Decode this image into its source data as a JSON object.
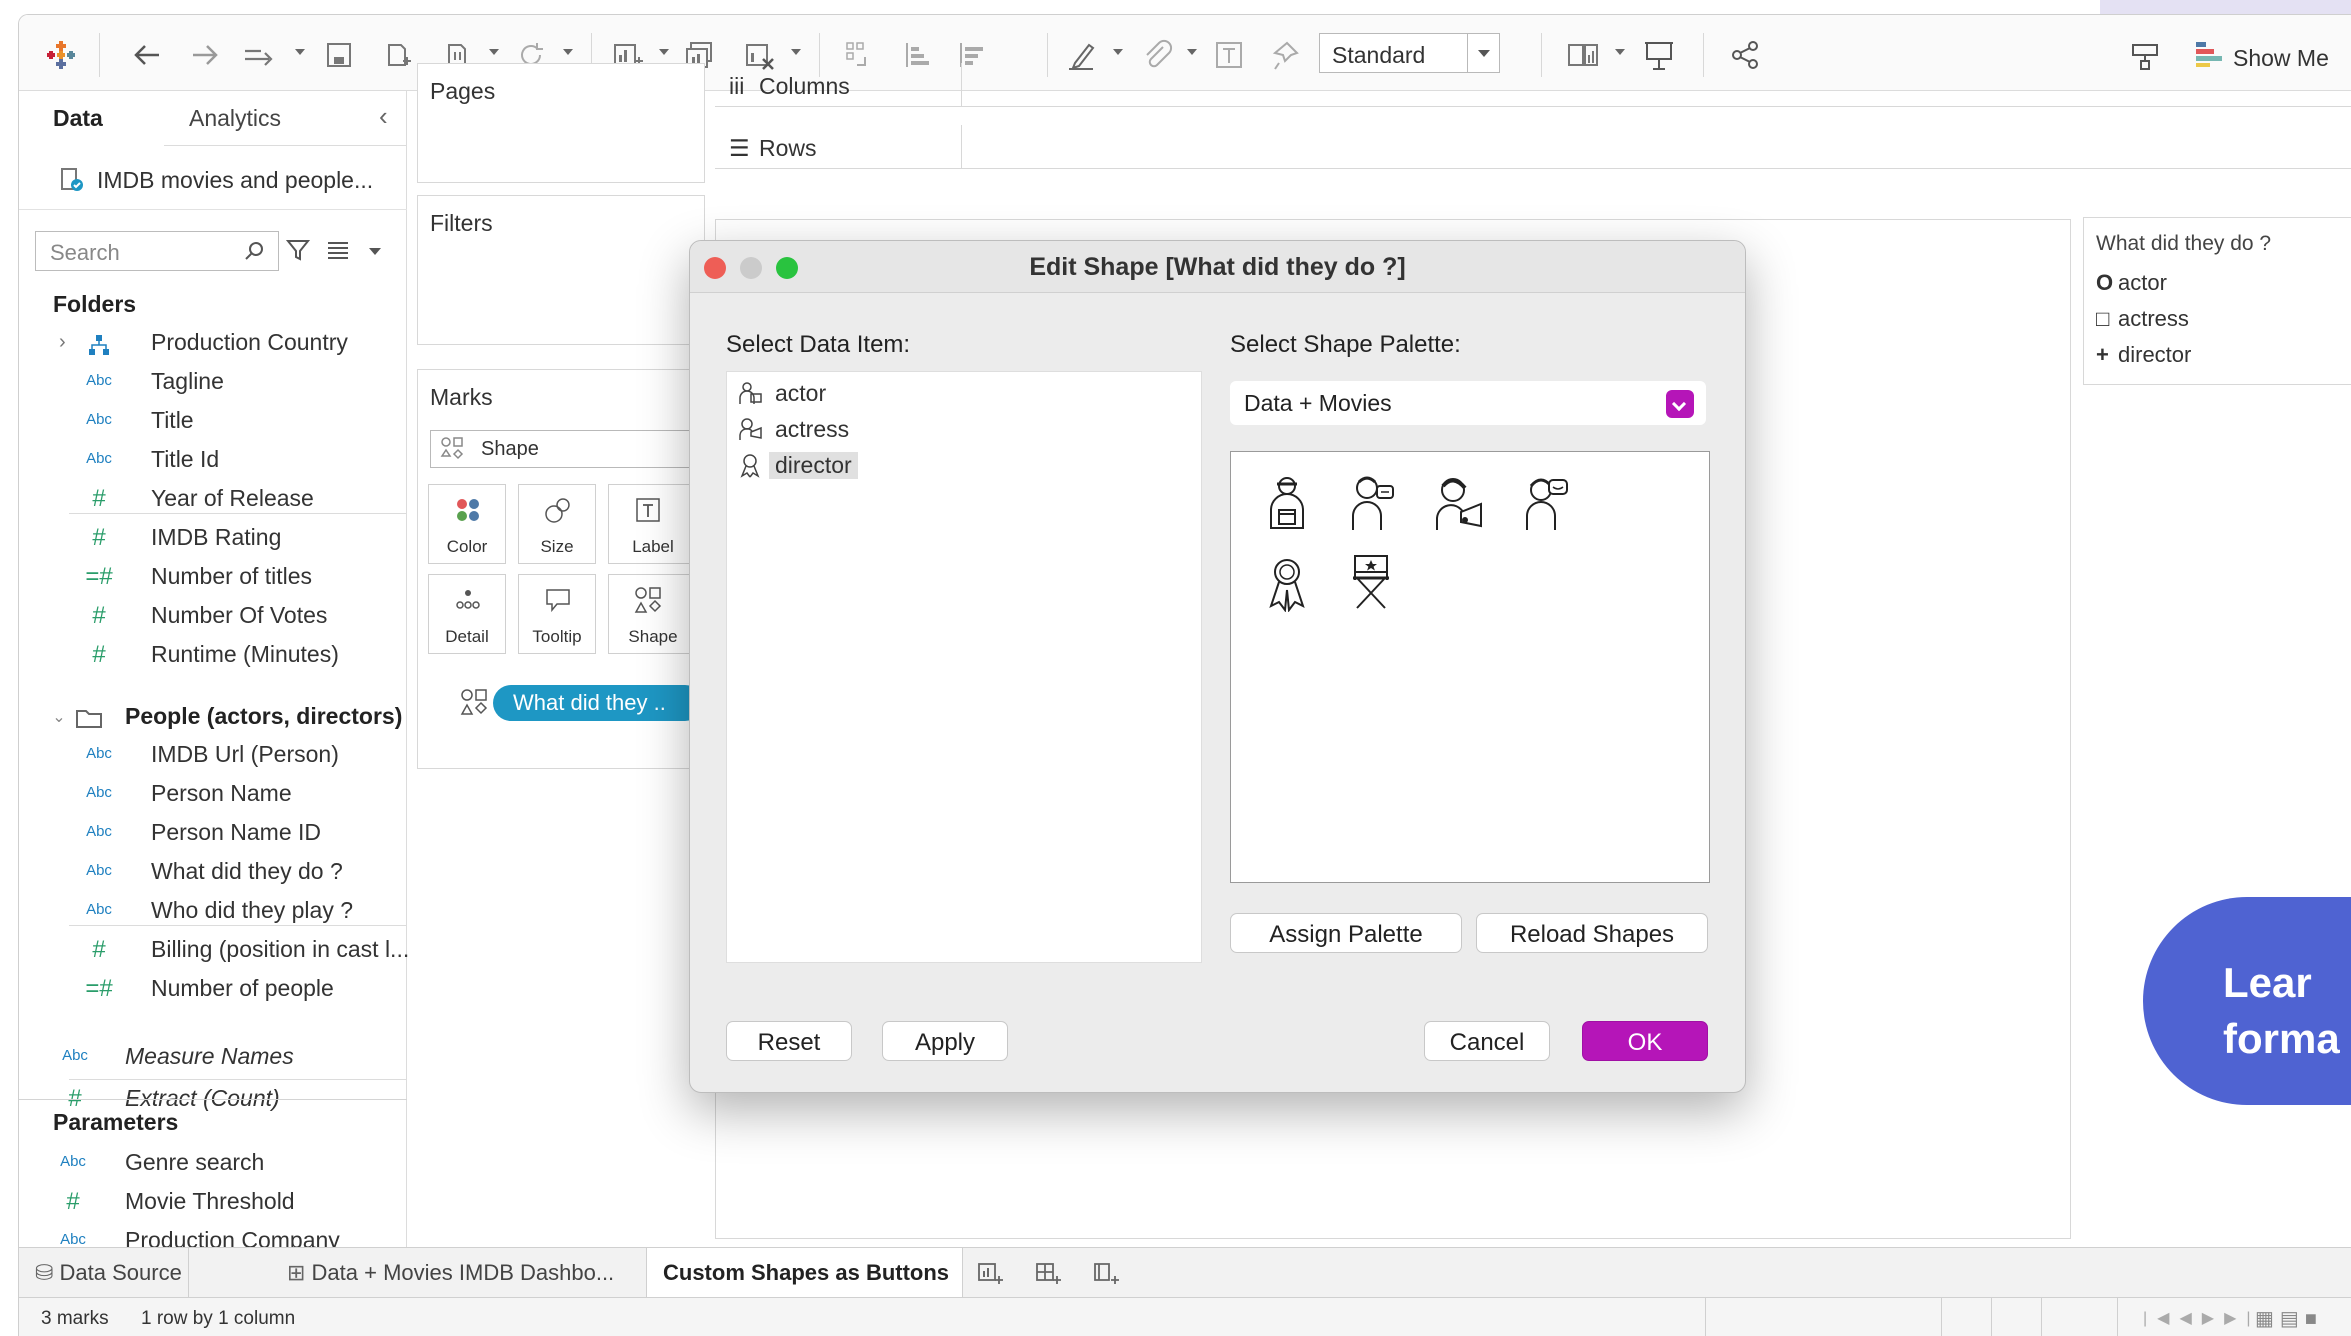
{
  "toolbar": {
    "standard_select": "Standard",
    "show_me": "Show Me"
  },
  "data_pane": {
    "tabs": {
      "data": "Data",
      "analytics": "Analytics"
    },
    "datasource": "IMDB movies and people...",
    "search_placeholder": "Search",
    "folders_heading": "Folders",
    "folder_fields": [
      {
        "type": "hier",
        "label": "Production Country"
      },
      {
        "type": "Abc",
        "label": "Tagline"
      },
      {
        "type": "Abc",
        "label": "Title"
      },
      {
        "type": "Abc",
        "label": "Title Id"
      },
      {
        "type": "#",
        "label": "Year of Release"
      },
      {
        "type": "#",
        "label": "IMDB Rating"
      },
      {
        "type": "=#",
        "label": "Number of titles"
      },
      {
        "type": "#",
        "label": "Number Of Votes"
      },
      {
        "type": "#",
        "label": "Runtime (Minutes)"
      }
    ],
    "people_folder": "People (actors, directors)",
    "people_fields": [
      {
        "type": "Abc",
        "label": "IMDB Url (Person)"
      },
      {
        "type": "Abc",
        "label": "Person Name"
      },
      {
        "type": "Abc",
        "label": "Person Name ID"
      },
      {
        "type": "Abc",
        "label": "What did they do ?"
      },
      {
        "type": "Abc",
        "label": "Who did they play ?"
      },
      {
        "type": "#",
        "label": "Billing (position in cast l..."
      },
      {
        "type": "=#",
        "label": "Number of people"
      }
    ],
    "measure_names": "Measure Names",
    "extract_count": "Extract (Count)",
    "parameters_heading": "Parameters",
    "parameters": [
      {
        "type": "Abc",
        "label": "Genre search"
      },
      {
        "type": "#",
        "label": "Movie Threshold"
      },
      {
        "type": "Abc",
        "label": "Production Company"
      }
    ]
  },
  "shelves": {
    "pages": "Pages",
    "filters": "Filters",
    "marks": "Marks",
    "marks_type": "Shape",
    "marks_buttons": [
      "Color",
      "Size",
      "Label",
      "Detail",
      "Tooltip",
      "Shape"
    ],
    "pill": "What did they ..",
    "columns": "Columns",
    "rows": "Rows"
  },
  "legend": {
    "title": "What did they do ?",
    "items": [
      {
        "symbol": "O",
        "label": "actor"
      },
      {
        "symbol": "□",
        "label": "actress"
      },
      {
        "symbol": "+",
        "label": "director"
      }
    ]
  },
  "learn_button": {
    "line1": "Lear",
    "line2": "forma"
  },
  "dialog": {
    "title": "Edit Shape [What did they do ?]",
    "select_data_item": "Select Data Item:",
    "select_shape_palette": "Select Shape Palette:",
    "items": [
      "actor",
      "actress",
      "director"
    ],
    "selected_item": "director",
    "palette": "Data + Movies",
    "shapes": [
      "clapper-person-icon",
      "theater-masks-person-icon",
      "film-reel-person-icon",
      "comedy-masks-person-icon",
      "award-ribbon-icon",
      "director-chair-icon"
    ],
    "buttons": {
      "assign_palette": "Assign Palette",
      "reload_shapes": "Reload Shapes",
      "reset": "Reset",
      "apply": "Apply",
      "cancel": "Cancel",
      "ok": "OK"
    }
  },
  "bottom_tabs": {
    "data_source": "Data Source",
    "dashboard": "Data + Movies IMDB Dashbo...",
    "sheet": "Custom Shapes as Buttons"
  },
  "status": {
    "marks": "3 marks",
    "rows": "1 row by 1 column"
  },
  "colors": {
    "accent": "#b515b8",
    "pill": "#1e97c4",
    "learn": "#4f63d2"
  }
}
